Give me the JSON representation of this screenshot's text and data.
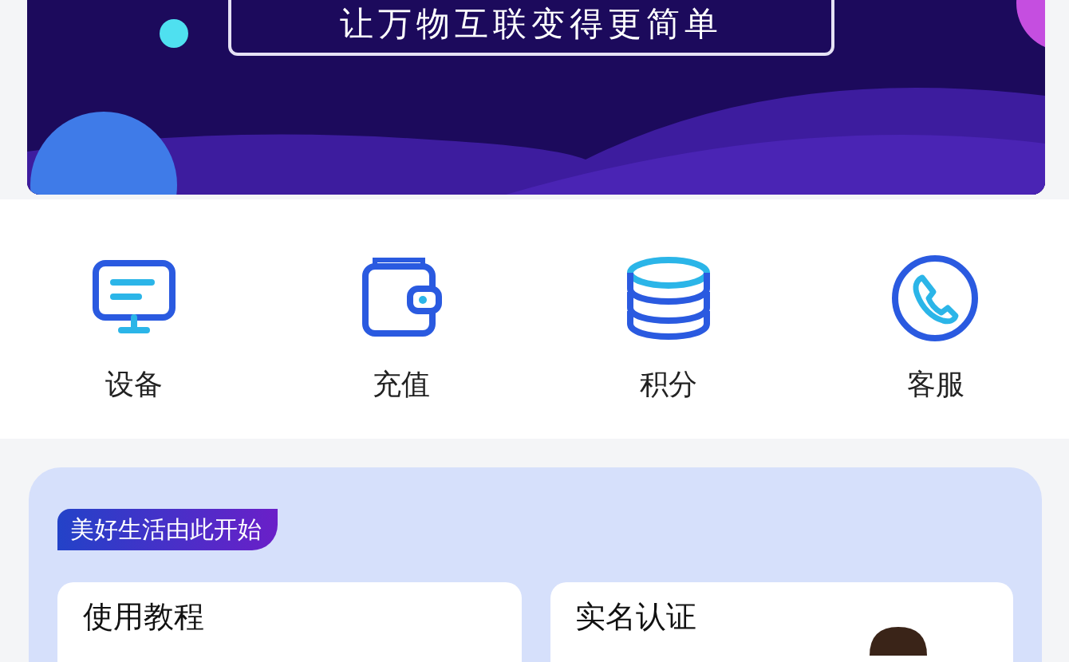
{
  "banner": {
    "slogan": "让万物互联变得更简单"
  },
  "shortcuts": [
    {
      "label": "设备",
      "kind": "device"
    },
    {
      "label": "充值",
      "kind": "recharge"
    },
    {
      "label": "积分",
      "kind": "points"
    },
    {
      "label": "客服",
      "kind": "service"
    }
  ],
  "section": {
    "tag": "美好生活由此开始",
    "cards": [
      {
        "title": "使用教程",
        "kind": "plain"
      },
      {
        "title": "实名认证",
        "kind": "figure"
      }
    ]
  }
}
